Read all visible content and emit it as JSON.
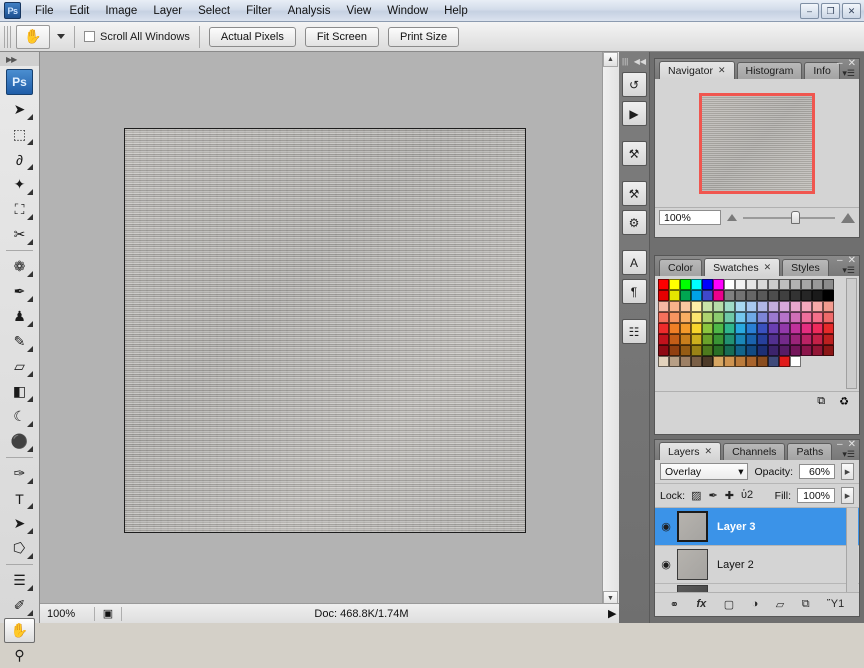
{
  "titlebar": {
    "logo": "Ps",
    "menus": [
      "File",
      "Edit",
      "Image",
      "Layer",
      "Select",
      "Filter",
      "Analysis",
      "View",
      "Window",
      "Help"
    ],
    "window_buttons": [
      {
        "name": "minimize",
        "glyph": "–"
      },
      {
        "name": "restore",
        "glyph": "❐"
      },
      {
        "name": "close",
        "glyph": "✕"
      }
    ]
  },
  "options_bar": {
    "active_tool_icon": "hand-icon",
    "active_tool_glyph": "✋",
    "checkbox_label": "Scroll All Windows",
    "checkbox_checked": false,
    "buttons": [
      "Actual Pixels",
      "Fit Screen",
      "Print Size"
    ]
  },
  "toolbox": {
    "logo": "Ps",
    "groups": [
      [
        {
          "name": "move-tool",
          "glyph": "➤",
          "has_submenu": true,
          "selected": false
        },
        {
          "name": "marquee-tool",
          "glyph": "⬚",
          "has_submenu": true,
          "selected": false
        },
        {
          "name": "lasso-tool",
          "glyph": "∂",
          "has_submenu": true,
          "selected": false
        },
        {
          "name": "magic-wand-tool",
          "glyph": "✦",
          "has_submenu": true,
          "selected": false
        },
        {
          "name": "crop-tool",
          "glyph": "⛶",
          "has_submenu": true,
          "selected": false
        },
        {
          "name": "slice-tool",
          "glyph": "✂",
          "has_submenu": true,
          "selected": false
        }
      ],
      [
        {
          "name": "healing-brush-tool",
          "glyph": "❁",
          "has_submenu": true,
          "selected": false
        },
        {
          "name": "brush-tool",
          "glyph": "✒",
          "has_submenu": true,
          "selected": false
        },
        {
          "name": "clone-stamp-tool",
          "glyph": "♟",
          "has_submenu": true,
          "selected": false
        },
        {
          "name": "history-brush-tool",
          "glyph": "✎",
          "has_submenu": true,
          "selected": false
        },
        {
          "name": "eraser-tool",
          "glyph": "▱",
          "has_submenu": true,
          "selected": false
        },
        {
          "name": "gradient-tool",
          "glyph": "◧",
          "has_submenu": true,
          "selected": false
        },
        {
          "name": "blur-tool",
          "glyph": "☾",
          "has_submenu": true,
          "selected": false
        },
        {
          "name": "dodge-tool",
          "glyph": "⚫",
          "has_submenu": true,
          "selected": false
        }
      ],
      [
        {
          "name": "pen-tool",
          "glyph": "✑",
          "has_submenu": true,
          "selected": false
        },
        {
          "name": "type-tool",
          "glyph": "T",
          "has_submenu": true,
          "selected": false
        },
        {
          "name": "path-selection-tool",
          "glyph": "➤",
          "has_submenu": true,
          "selected": false
        },
        {
          "name": "shape-tool",
          "glyph": "⭔",
          "has_submenu": true,
          "selected": false
        }
      ],
      [
        {
          "name": "notes-tool",
          "glyph": "☰",
          "has_submenu": true,
          "selected": false
        },
        {
          "name": "eyedropper-tool",
          "glyph": "✐",
          "has_submenu": true,
          "selected": false
        },
        {
          "name": "hand-tool",
          "glyph": "✋",
          "has_submenu": false,
          "selected": true
        },
        {
          "name": "zoom-tool",
          "glyph": "⚲",
          "has_submenu": false,
          "selected": false
        }
      ]
    ]
  },
  "status_bar": {
    "zoom": "100%",
    "doc_info": "Doc: 468.8K/1.74M"
  },
  "icon_strip": {
    "icons": [
      {
        "name": "history-panel-icon",
        "glyph": "↺"
      },
      {
        "name": "actions-panel-icon",
        "glyph": "▶"
      },
      {
        "name": "tool-presets-panel-icon",
        "glyph": "⚒"
      },
      {
        "name": "brushes-panel-icon",
        "glyph": "⚒"
      },
      {
        "name": "clone-source-panel-icon",
        "glyph": "⚙"
      },
      {
        "name": "character-panel-icon",
        "glyph": "A"
      },
      {
        "name": "paragraph-panel-icon",
        "glyph": "¶"
      },
      {
        "name": "layer-comps-panel-icon",
        "glyph": "☷"
      }
    ]
  },
  "navigator_panel": {
    "tabs": [
      {
        "label": "Navigator",
        "active": true,
        "closable": true
      },
      {
        "label": "Histogram",
        "active": false,
        "closable": false
      },
      {
        "label": "Info",
        "active": false,
        "closable": false
      }
    ],
    "zoom_value": "100%",
    "view_box_color": "#f0564f"
  },
  "color_panel": {
    "tabs": [
      {
        "label": "Color",
        "active": false,
        "closable": false
      },
      {
        "label": "Swatches",
        "active": true,
        "closable": true
      },
      {
        "label": "Styles",
        "active": false,
        "closable": false
      }
    ],
    "swatches": [
      "#fe0000",
      "#ffff00",
      "#00ff00",
      "#00ffff",
      "#0000fe",
      "#ff00ff",
      "#ffffff",
      "#f2f2f2",
      "#e6e6e6",
      "#d9d9d9",
      "#cccccc",
      "#bfbfbf",
      "#b3b3b3",
      "#a6a6a6",
      "#999999",
      "#8c8c8c",
      "#e60000",
      "#e6e600",
      "#00a651",
      "#00a2e8",
      "#3f48cc",
      "#ec008c",
      "#808080",
      "#737373",
      "#666666",
      "#595959",
      "#4d4d4d",
      "#404040",
      "#333333",
      "#262626",
      "#1a1a1a",
      "#000000",
      "#f7b7a3",
      "#f9b38a",
      "#fac7a0",
      "#fdf0a8",
      "#c9e3a8",
      "#b6dca8",
      "#9fdcc8",
      "#a9d9f2",
      "#a8c8ef",
      "#b0b6e6",
      "#c3aede",
      "#d6a8da",
      "#e9a6cd",
      "#f5a8bd",
      "#f7a9a9",
      "#f29b8f",
      "#f4705c",
      "#f79560",
      "#f9ae63",
      "#fbe46f",
      "#aed36f",
      "#8ccb6f",
      "#6fc9a8",
      "#74c7ee",
      "#6fa9e6",
      "#7d85d8",
      "#9b79cf",
      "#b673c9",
      "#d06fb7",
      "#ee6f9c",
      "#f4708a",
      "#ef6a6a",
      "#ee2b2b",
      "#f07f26",
      "#f49a2a",
      "#f7d52c",
      "#8cc63f",
      "#4fb848",
      "#2fb68e",
      "#29a9e0",
      "#2a7fd4",
      "#3a51bf",
      "#6a3fb2",
      "#9239ab",
      "#c0329b",
      "#e52e80",
      "#ee2b5c",
      "#e62a2a",
      "#c1121c",
      "#c45d17",
      "#c97f1c",
      "#cdb01e",
      "#6ba32b",
      "#3a9535",
      "#229272",
      "#1a87b8",
      "#1a63ad",
      "#27409c",
      "#52308f",
      "#742a8a",
      "#9b2479",
      "#bb2365",
      "#c42148",
      "#bd2020",
      "#8f0a13",
      "#913f10",
      "#955c14",
      "#9a8316",
      "#4e7a1e",
      "#2a6f26",
      "#176c54",
      "#12648a",
      "#124a82",
      "#1c2f75",
      "#3c236b",
      "#571d67",
      "#74155a",
      "#8c154b",
      "#931636",
      "#8c1616",
      "#e3d3bd",
      "#b79f86",
      "#9d8065",
      "#7a5f46",
      "#4d3a28",
      "#d8a763",
      "#cf9450",
      "#bb7b3b",
      "#a9642c",
      "#8a4d1f",
      "#3f4a7a",
      "#e01b1b",
      "#ffffff"
    ]
  },
  "layers_panel": {
    "tabs": [
      {
        "label": "Layers",
        "active": true,
        "closable": true
      },
      {
        "label": "Channels",
        "active": false,
        "closable": false
      },
      {
        "label": "Paths",
        "active": false,
        "closable": false
      }
    ],
    "blend_mode": "Overlay",
    "opacity_label": "Opacity:",
    "opacity_value": "60%",
    "lock_label": "Lock:",
    "lock_icons": [
      {
        "name": "lock-transparent-pixels-icon",
        "glyph": "▨"
      },
      {
        "name": "lock-image-pixels-icon",
        "glyph": "✒"
      },
      {
        "name": "lock-position-icon",
        "glyph": "✚"
      },
      {
        "name": "lock-all-icon",
        "glyph": "ὑ2"
      }
    ],
    "fill_label": "Fill:",
    "fill_value": "100%",
    "layers": [
      {
        "name": "Layer 3",
        "visible": true,
        "selected": true
      },
      {
        "name": "Layer 2",
        "visible": true,
        "selected": false
      }
    ],
    "footer_buttons": [
      {
        "name": "link-layers-button",
        "glyph": "⚭"
      },
      {
        "name": "layer-style-button",
        "glyph": "fx"
      },
      {
        "name": "add-layer-mask-button",
        "glyph": "▢"
      },
      {
        "name": "adjustment-layer-button",
        "glyph": "◑"
      },
      {
        "name": "new-group-button",
        "glyph": "▱"
      },
      {
        "name": "new-layer-button",
        "glyph": "⧉"
      },
      {
        "name": "delete-layer-button",
        "glyph": "Ὕ1"
      }
    ],
    "highlight_color": "#3b93e8"
  }
}
